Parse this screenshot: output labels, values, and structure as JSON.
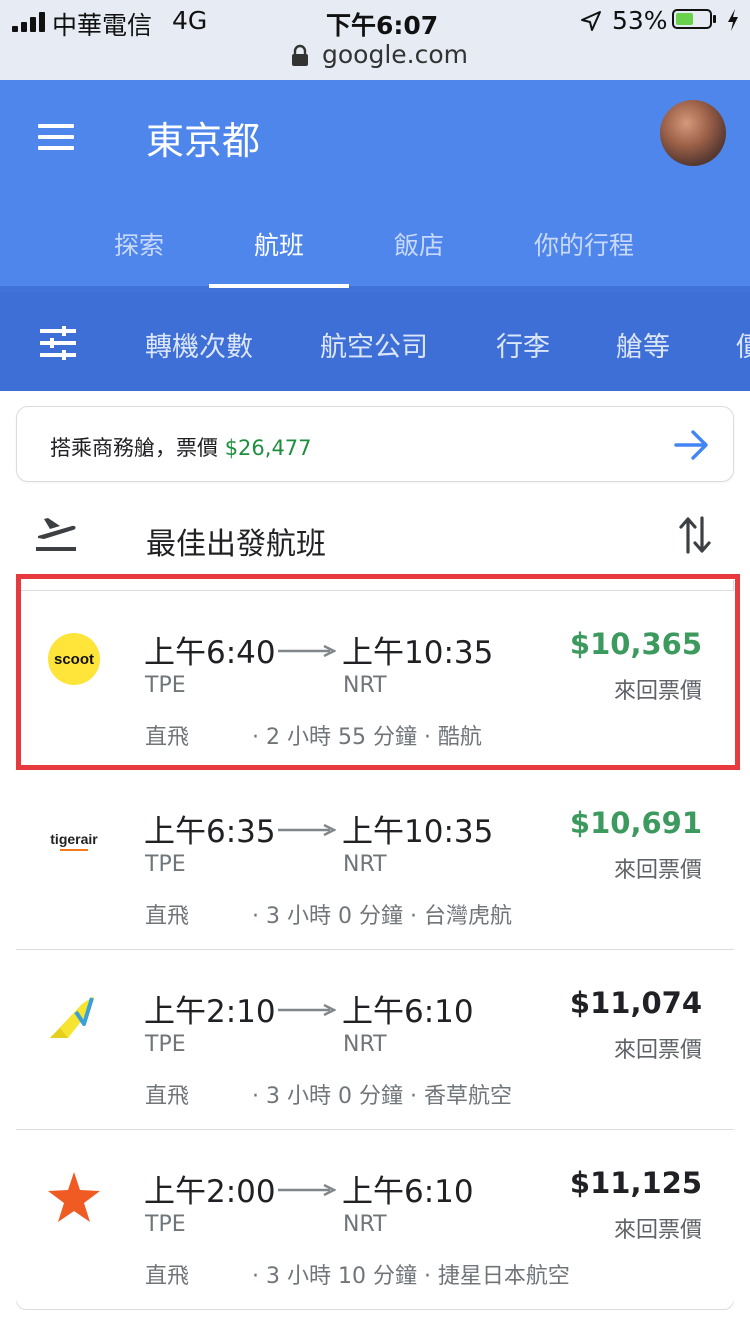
{
  "status_bar": {
    "carrier": "中華電信",
    "network": "4G",
    "time": "下午6:07",
    "battery_percent": "53%",
    "battery_level": 0.53
  },
  "browser": {
    "url": "google.com"
  },
  "header": {
    "title": "東京都",
    "tabs": [
      {
        "label": "探索",
        "active": false
      },
      {
        "label": "航班",
        "active": true
      },
      {
        "label": "飯店",
        "active": false
      },
      {
        "label": "你的行程",
        "active": false
      }
    ]
  },
  "filters": {
    "items": [
      "轉機次數",
      "航空公司",
      "行李",
      "艙等",
      "價"
    ]
  },
  "banner": {
    "text": "搭乘商務艙，票價 ",
    "price": "$26,477"
  },
  "section": {
    "title": "最佳出發航班"
  },
  "flights": [
    {
      "logo": "scoot-logo",
      "logo_text": "scoot",
      "dep_time": "上午6:40",
      "arr_time": "上午10:35",
      "dep_code": "TPE",
      "arr_code": "NRT",
      "stops": "直飛",
      "details": "· 2 小時 55 分鐘 · 酷航",
      "price": "$10,365",
      "price_color": "#3c9a5f",
      "price_label": "來回票價",
      "highlighted": true
    },
    {
      "logo": "tigerair-logo",
      "logo_text": "tigerair",
      "dep_time": "上午6:35",
      "arr_time": "上午10:35",
      "dep_code": "TPE",
      "arr_code": "NRT",
      "stops": "直飛",
      "details": "· 3 小時 0 分鐘 · 台灣虎航",
      "price": "$10,691",
      "price_color": "#3c9a5f",
      "price_label": "來回票價",
      "highlighted": false
    },
    {
      "logo": "vanilla-air-logo",
      "dep_time": "上午2:10",
      "arr_time": "上午6:10",
      "dep_code": "TPE",
      "arr_code": "NRT",
      "stops": "直飛",
      "details": "· 3 小時 0 分鐘 · 香草航空",
      "price": "$11,074",
      "price_color": "#202124",
      "price_label": "來回票價",
      "highlighted": false
    },
    {
      "logo": "jetstar-logo",
      "dep_time": "上午2:00",
      "arr_time": "上午6:10",
      "dep_code": "TPE",
      "arr_code": "NRT",
      "stops": "直飛",
      "details": "· 3 小時 10 分鐘 · 捷星日本航空",
      "price": "$11,125",
      "price_color": "#202124",
      "price_label": "來回票價",
      "highlighted": false
    }
  ]
}
